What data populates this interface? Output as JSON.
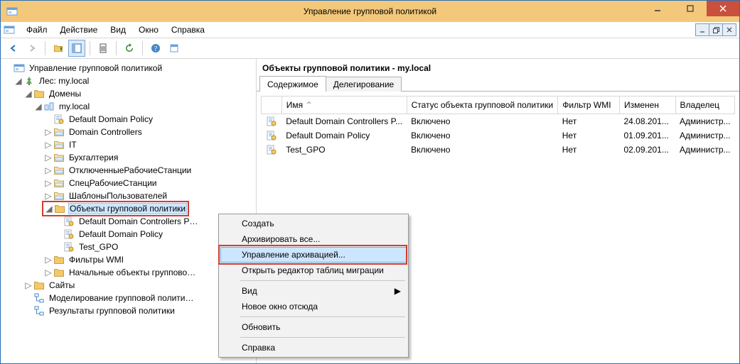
{
  "window": {
    "title": "Управление групповой политикой"
  },
  "menu": {
    "file": "Файл",
    "action": "Действие",
    "view": "Вид",
    "window_menu": "Окно",
    "help": "Справка"
  },
  "tree": {
    "root": "Управление групповой политикой",
    "forest": "Лес: my.local",
    "domains": "Домены",
    "domain": "my.local",
    "items": {
      "default_domain_policy": "Default Domain Policy",
      "domain_controllers": "Domain Controllers",
      "it": "IT",
      "accounting": "Бухгалтерия",
      "disabled_workstations": "ОтключенныеРабочиеСтанции",
      "spec_workstations": "СпецРабочиеСтанции",
      "user_templates": "ШаблоныПользователей",
      "gpo_container": "Объекты групповой политики",
      "gpo_children": {
        "ddcp": "Default Domain Controllers P…",
        "ddp": "Default Domain Policy",
        "test": "Test_GPO"
      },
      "wmi_filters": "Фильтры WMI",
      "starter_gpos": "Начальные объекты группово…"
    },
    "sites": "Сайты",
    "modeling": "Моделирование групповой полити…",
    "results": "Результаты групповой политики"
  },
  "detail": {
    "header": "Объекты групповой политики - my.local",
    "tabs": {
      "contents": "Содержимое",
      "delegation": "Делегирование"
    },
    "columns": {
      "name": "Имя",
      "status": "Статус объекта групповой политики",
      "wmi": "Фильтр WMI",
      "changed": "Изменен",
      "owner": "Владелец"
    },
    "rows": [
      {
        "name": "Default Domain Controllers P...",
        "status": "Включено",
        "wmi": "Нет",
        "changed": "24.08.201...",
        "owner": "Администр..."
      },
      {
        "name": "Default Domain Policy",
        "status": "Включено",
        "wmi": "Нет",
        "changed": "01.09.201...",
        "owner": "Администр..."
      },
      {
        "name": "Test_GPO",
        "status": "Включено",
        "wmi": "Нет",
        "changed": "02.09.201...",
        "owner": "Администр..."
      }
    ]
  },
  "context_menu": {
    "create": "Создать",
    "backup_all": "Архивировать все...",
    "manage_backups": "Управление архивацией...",
    "open_migration": "Открыть редактор таблиц миграции",
    "view": "Вид",
    "new_window": "Новое окно отсюда",
    "refresh": "Обновить",
    "help": "Справка"
  }
}
